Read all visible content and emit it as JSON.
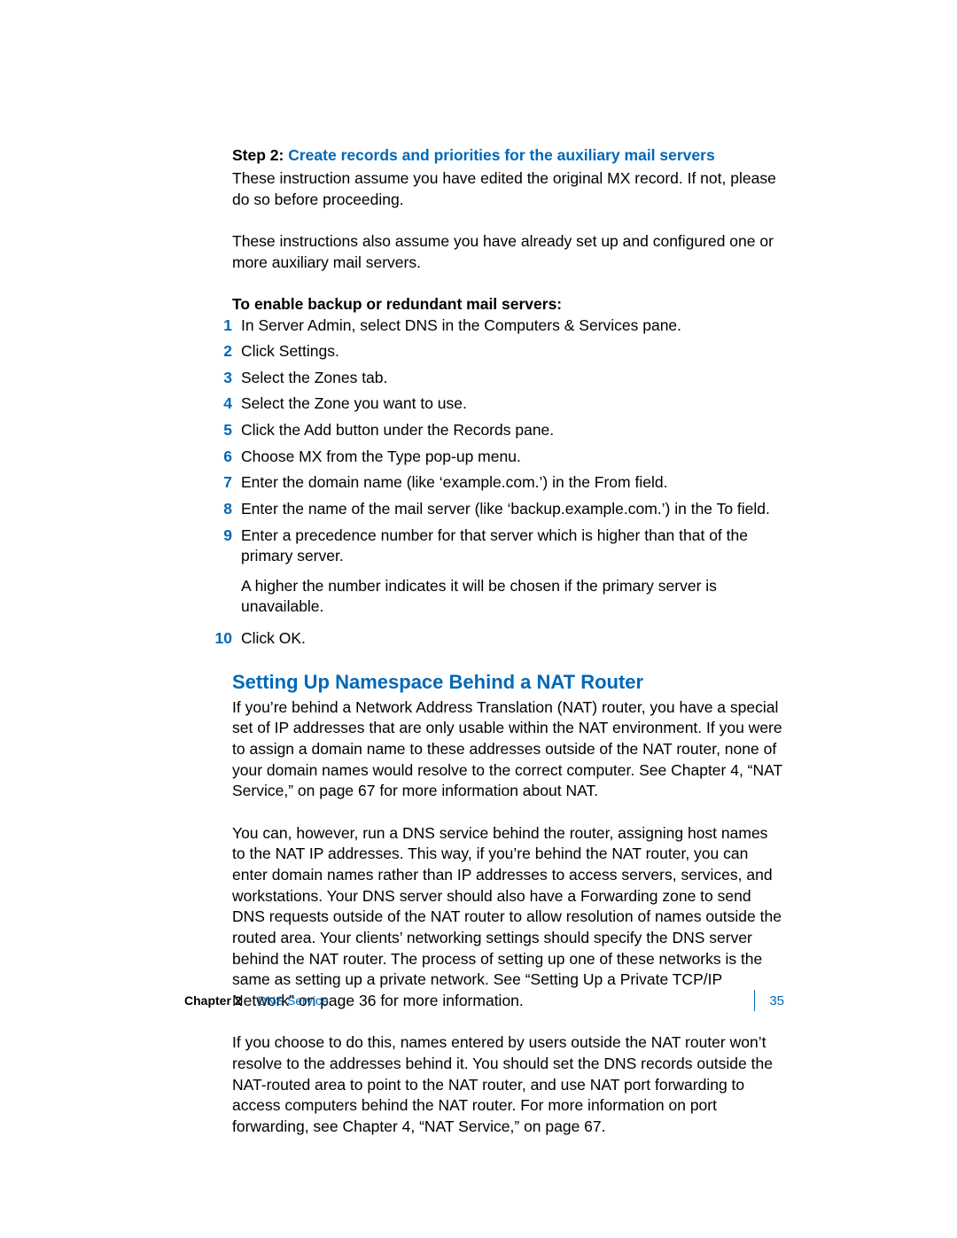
{
  "step": {
    "label": "Step 2:",
    "title": "Create records and priorities for the auxiliary mail servers"
  },
  "intro1": "These instruction assume you have edited the original MX record. If not, please do so before proceeding.",
  "intro2": "These instructions also assume you have already set up and configured one or more auxiliary mail servers.",
  "subHeading": "To enable backup or redundant mail servers:",
  "steps": [
    "In Server Admin, select DNS in the Computers & Services pane.",
    "Click Settings.",
    "Select the Zones tab.",
    "Select the Zone you want to use.",
    "Click the Add button under the Records pane.",
    "Choose MX from the Type pop-up menu.",
    "Enter the domain name (like ‘example.com.’) in the From field.",
    "Enter the name of the mail server (like ‘backup.example.com.’) in the To field.",
    "Enter a precedence number for that server which is higher than that of the primary server.",
    "Click OK."
  ],
  "stepNote": "A higher the number indicates it will be chosen if the primary server is unavailable.",
  "sectionTitle": "Setting Up Namespace Behind a NAT Router",
  "para1": "If you’re behind a Network Address Translation (NAT) router, you have a special set of IP addresses that are only usable within the NAT environment. If you were to assign a domain name to these addresses outside of the NAT router, none of your domain names would resolve to the correct computer. See Chapter 4, “NAT Service,” on page 67 for more information about NAT.",
  "para2": "You can, however, run a DNS service behind the router, assigning host names to the NAT IP addresses. This way, if you’re behind the NAT router, you can enter domain names rather than IP addresses to access servers, services, and workstations. Your DNS server should also have a Forwarding zone to send DNS requests outside of the NAT router to allow resolution of names outside the routed area. Your clients’ networking settings should specify the DNS server behind the NAT router. The process of setting up one of these networks is the same as setting up a private network. See “Setting Up a Private TCP/IP Network” on page 36 for more information.",
  "para3": "If you choose to do this, names entered by users outside the NAT router won’t resolve to the addresses behind it. You should set the DNS records outside the NAT-routed area to point to the NAT router, and use NAT port forwarding to access computers behind the NAT router. For more information on port forwarding, see Chapter 4, “NAT Service,” on page 67.",
  "footer": {
    "chapter": "Chapter 2",
    "service": "DNS Service",
    "page": "35"
  }
}
